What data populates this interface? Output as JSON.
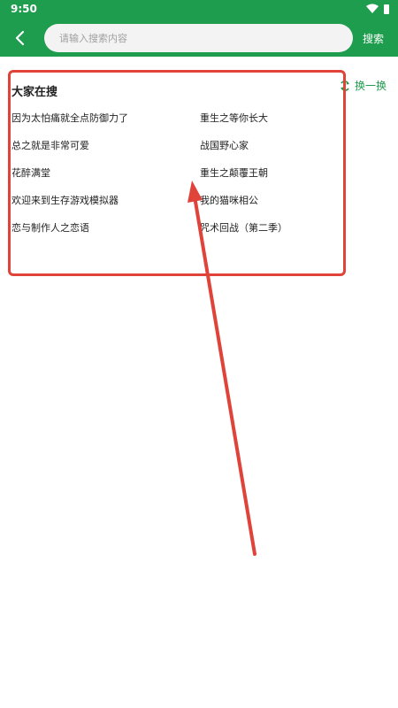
{
  "status_bar": {
    "time": "9:50"
  },
  "toolbar": {
    "search_placeholder": "请输入搜索内容",
    "search_label": "搜索"
  },
  "hot_searches": {
    "title": "大家在搜",
    "refresh_label": "换一换",
    "items": [
      "因为太怕痛就全点防御力了",
      "重生之等你长大",
      "总之就是非常可爱",
      "战国野心家",
      "花醉满堂",
      "重生之颠覆王朝",
      "欢迎来到生存游戏模拟器",
      "我的猫咪相公",
      "恋与制作人之恋语",
      "咒术回战（第二季）"
    ]
  },
  "colors": {
    "accent": "#1f9d4f",
    "annotation": "#e0433a"
  }
}
